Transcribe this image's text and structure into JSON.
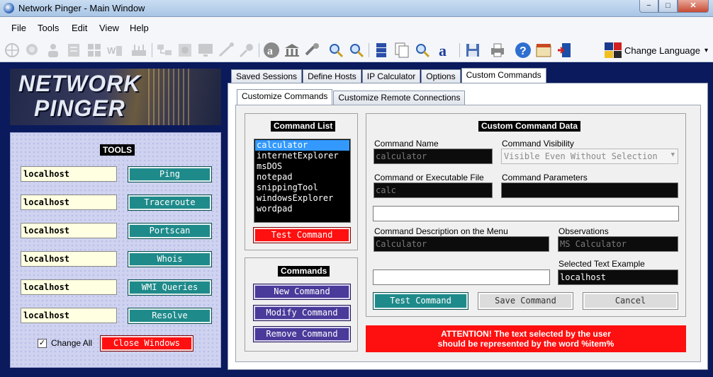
{
  "window": {
    "title": "Network Pinger - Main Window",
    "min": "−",
    "max": "□",
    "close": "✕"
  },
  "menu": [
    "File",
    "Tools",
    "Edit",
    "View",
    "Help"
  ],
  "toolbar": {
    "change_language": "Change Language",
    "dropdown_glyph": "▾"
  },
  "banner": {
    "line1": "NETWORK",
    "line2": "PINGER"
  },
  "tools": {
    "title": "TOOLS",
    "rows": [
      {
        "host": "localhost",
        "button": "Ping"
      },
      {
        "host": "localhost",
        "button": "Traceroute"
      },
      {
        "host": "localhost",
        "button": "Portscan"
      },
      {
        "host": "localhost",
        "button": "Whois"
      },
      {
        "host": "localhost",
        "button": "WMI Queries"
      },
      {
        "host": "localhost",
        "button": "Resolve"
      }
    ],
    "change_all": "Change All",
    "change_all_checked": true,
    "close_windows": "Close Windows"
  },
  "tabs": [
    "Saved Sessions",
    "Define Hosts",
    "IP Calculator",
    "Options",
    "Custom Commands"
  ],
  "active_tab": "Custom Commands",
  "subtabs": [
    "Customize Commands",
    "Customize Remote Connections"
  ],
  "active_subtab": "Customize Commands",
  "command_list": {
    "title": "Command List",
    "items": [
      "calculator",
      "internetExplorer",
      "msDOS",
      "notepad",
      "snippingTool",
      "windowsExplorer",
      "wordpad"
    ],
    "selected": "calculator",
    "test_button": "Test Command"
  },
  "commands": {
    "title": "Commands",
    "new": "New Command",
    "modify": "Modify Command",
    "remove": "Remove Command"
  },
  "custom_data": {
    "title": "Custom Command Data",
    "command_name_label": "Command Name",
    "command_name": "calculator",
    "visibility_label": "Command Visibility",
    "visibility": "Visible Even Without Selection",
    "executable_label": "Command or Executable File",
    "executable": "calc",
    "parameters_label": "Command Parameters",
    "parameters": "",
    "extra_field": "",
    "description_label": "Command Description on the Menu",
    "description": "Calculator",
    "observations_label": "Observations",
    "observations": "MS Calculator",
    "selected_example_label": "Selected Text Example",
    "selected_example": "localhost",
    "preview_field": "",
    "test_button": "Test Command",
    "save_button": "Save Command",
    "cancel_button": "Cancel"
  },
  "attention": {
    "line1": "ATTENTION! The text selected by the user",
    "line2": "should be represented by the word %item%"
  },
  "colors": {
    "teal": "#1f8a8a",
    "red": "#ff1010",
    "purple": "#4a3a9a",
    "navy_bg": "#0a1a5c"
  }
}
